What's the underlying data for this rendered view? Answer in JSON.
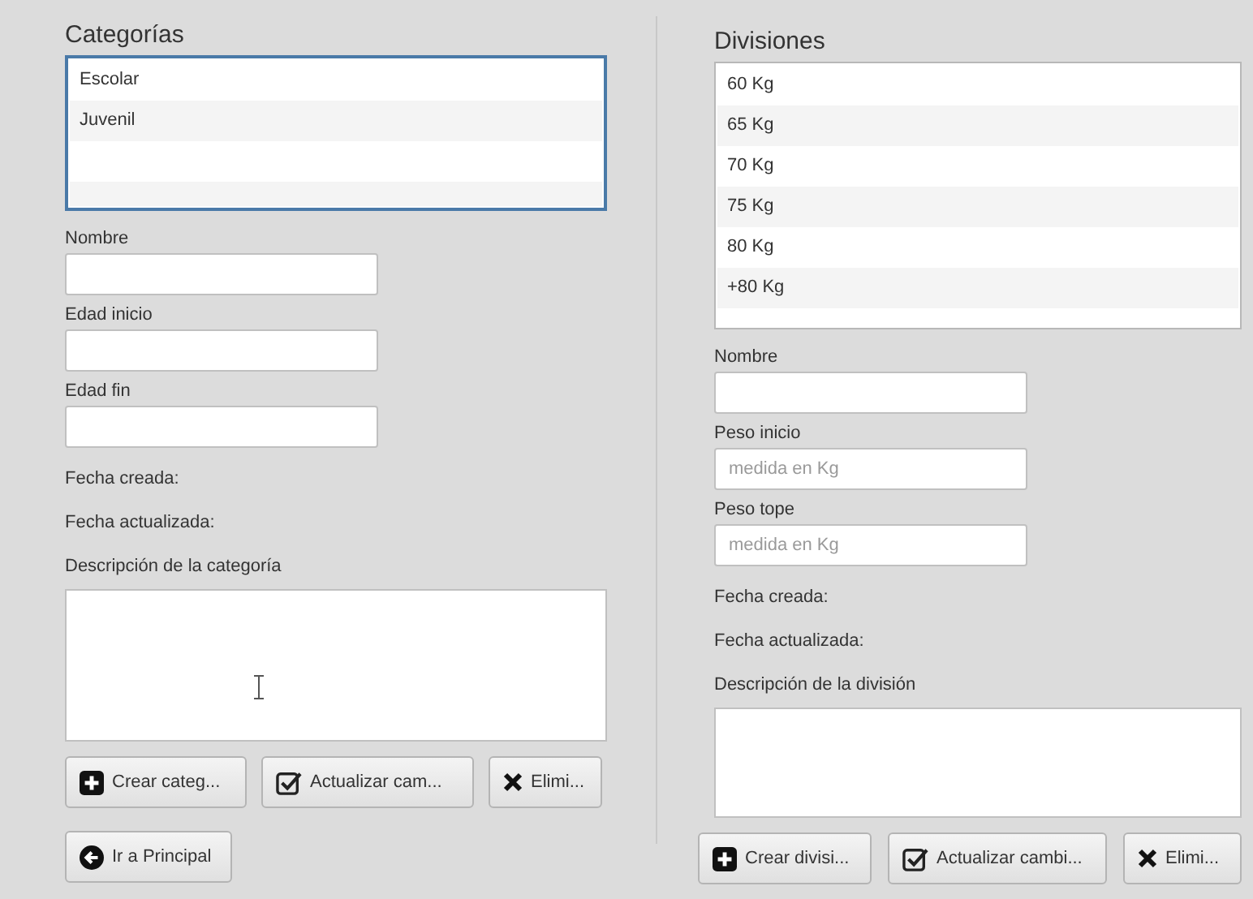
{
  "left_panel": {
    "title": "Categorías",
    "list": {
      "focused": true,
      "items": [
        {
          "label": "Escolar"
        },
        {
          "label": "Juvenil"
        }
      ]
    },
    "fields": [
      {
        "label": "Nombre"
      },
      {
        "label": "Edad inicio"
      },
      {
        "label": "Edad fin"
      }
    ],
    "info": [
      "Fecha creada:",
      "Fecha actualizada:"
    ],
    "description_label": "Descripción de la categoría",
    "buttons": [
      {
        "kind": "add",
        "label": "Crear categ..."
      },
      {
        "kind": "check",
        "label": "Actualizar cam..."
      },
      {
        "kind": "delete",
        "label": "Elimi..."
      }
    ],
    "back_button": {
      "kind": "back",
      "label": "Ir a Principal"
    }
  },
  "right_panel": {
    "title": "Divisiones",
    "list": {
      "focused": false,
      "items": [
        {
          "label": "60 Kg"
        },
        {
          "label": "65 Kg"
        },
        {
          "label": "70 Kg"
        },
        {
          "label": "75 Kg"
        },
        {
          "label": "80 Kg"
        },
        {
          "label": "+80 Kg"
        }
      ]
    },
    "fields": [
      {
        "label": "Nombre"
      },
      {
        "label": "Peso inicio",
        "placeholder": "medida en Kg"
      },
      {
        "label": "Peso tope",
        "placeholder": "medida en Kg"
      }
    ],
    "info": [
      "Fecha creada:",
      "Fecha actualizada:"
    ],
    "description_label": "Descripción de la división",
    "buttons": [
      {
        "kind": "add",
        "label": "Crear divisi..."
      },
      {
        "kind": "check",
        "label": "Actualizar cambi..."
      },
      {
        "kind": "delete",
        "label": "Elimi..."
      }
    ]
  }
}
